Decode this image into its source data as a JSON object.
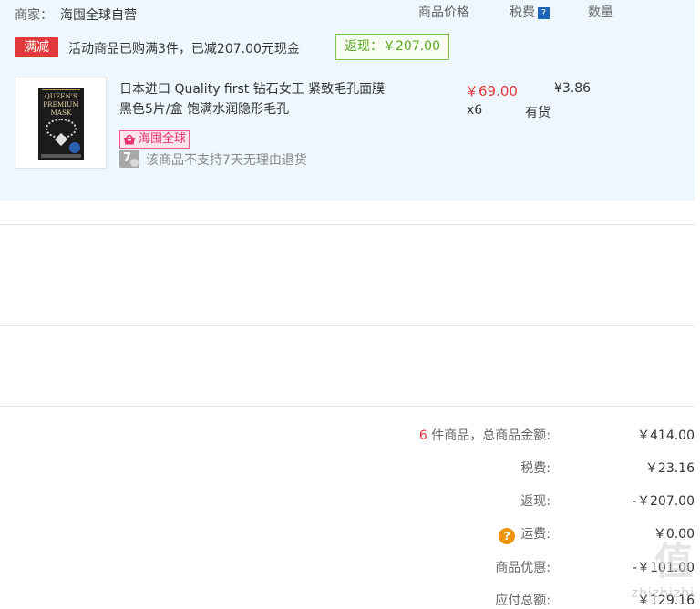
{
  "header": {
    "merchant_label": "商家：",
    "merchant_name": "海囤全球自营",
    "col_price": "商品价格",
    "col_tax": "税费",
    "tax_help_icon": "?",
    "col_qty": "数量"
  },
  "promo": {
    "badge": "满减",
    "text": "活动商品已购满3件，已减207.00元现金",
    "rebate": "返现：￥207.00"
  },
  "item": {
    "thumb_lines": [
      "QUEEN'S",
      "PREMIUM",
      "MASK"
    ],
    "title_line1": "日本进口 Quality first 钻石女王 紧致毛孔面膜",
    "title_line2": "黑色5片/盒 饱满水润隐形毛孔",
    "price": "￥69.00",
    "tax": "¥3.86",
    "qty": "x6",
    "stock": "有货",
    "haitao_tag": "海囤全球",
    "seven_day_icon": "7",
    "no_return_text": "该商品不支持7天无理由退货"
  },
  "summary": {
    "count": "6",
    "count_suffix": " 件商品，总商品金额:",
    "total_value": "￥414.00",
    "tax_label": "税费:",
    "tax_value": "￥23.16",
    "rebate_label": "返现:",
    "rebate_value": "-￥207.00",
    "shipping_help_icon": "?",
    "shipping_label": "运费:",
    "shipping_value": "￥0.00",
    "discount_label": "商品优惠:",
    "discount_value": "-￥101.00",
    "payable_label": "应付总额:",
    "payable_value": "￥129.16"
  },
  "watermark": {
    "big": "值",
    "small": "zhizhizhi"
  }
}
